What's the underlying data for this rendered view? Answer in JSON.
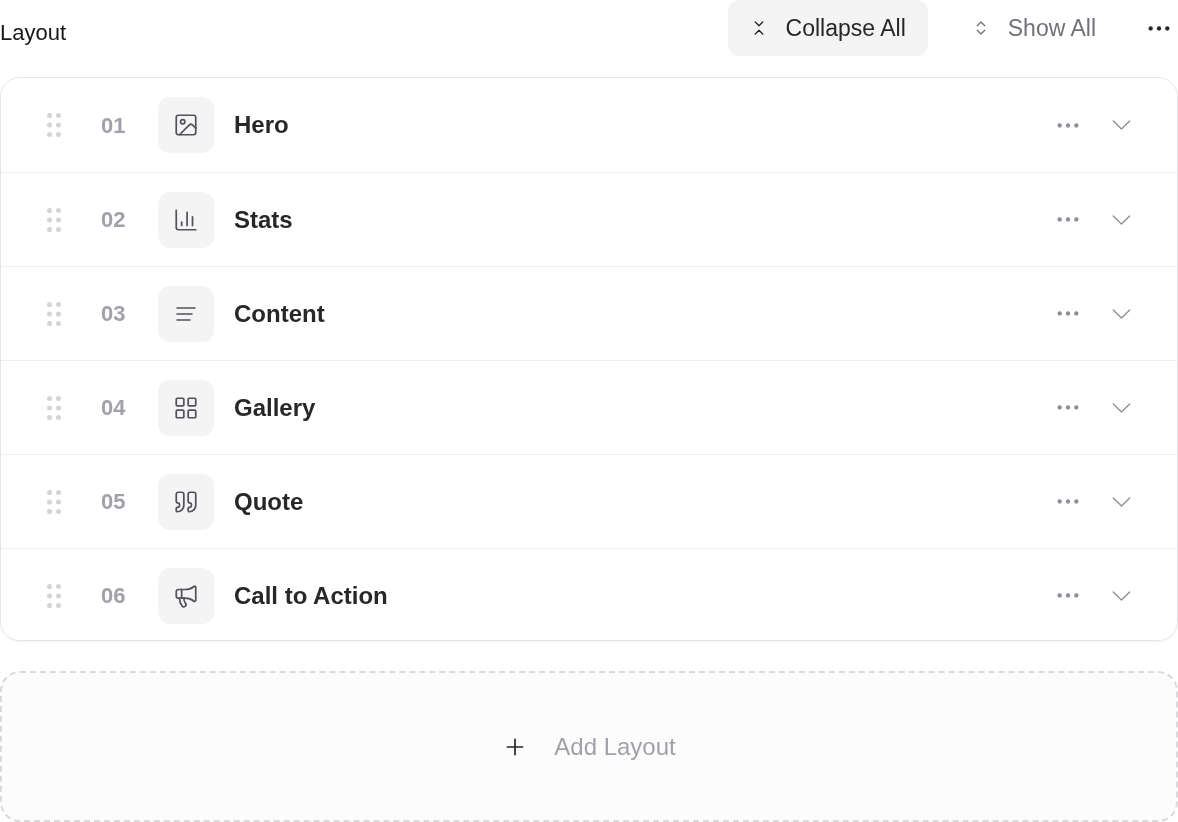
{
  "header": {
    "title": "Layout",
    "actions": [
      {
        "label": "Collapse All",
        "selected": true
      },
      {
        "label": "Show All",
        "selected": false
      }
    ]
  },
  "sections": [
    {
      "number": "01",
      "title": "Hero",
      "expanded": false
    },
    {
      "number": "02",
      "title": "Stats",
      "expanded": false
    },
    {
      "number": "03",
      "title": "Content",
      "expanded": false
    },
    {
      "number": "04",
      "title": "Gallery",
      "expanded": false
    },
    {
      "number": "05",
      "title": "Quote",
      "expanded": false
    },
    {
      "number": "06",
      "title": "Call to Action",
      "expanded": false
    }
  ],
  "add_button": {
    "label": "Add Layout"
  }
}
